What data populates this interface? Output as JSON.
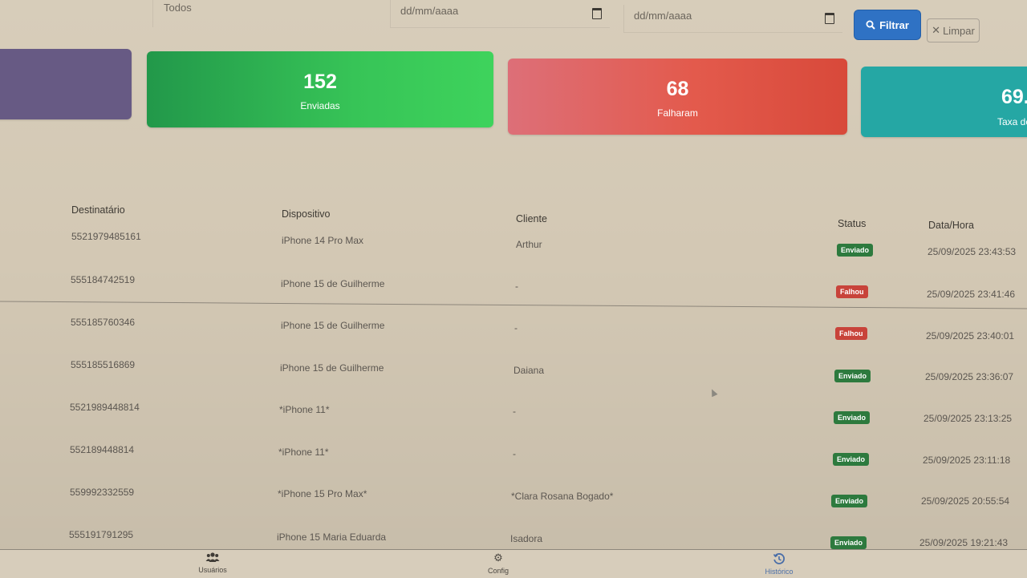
{
  "filters": {
    "status_value": "Todos",
    "date_start_placeholder": "dd/mm/aaaa",
    "date_end_placeholder": "dd/mm/aaaa",
    "filter_button": "Filtrar",
    "clear_button": "Limpar"
  },
  "stats": {
    "sent": {
      "value": "152",
      "label": "Enviadas"
    },
    "failed": {
      "value": "68",
      "label": "Falharam"
    },
    "rate": {
      "value": "69.",
      "label": "Taxa de"
    }
  },
  "table": {
    "columns": [
      "Destinatário",
      "Dispositivo",
      "Cliente",
      "Status",
      "Data/Hora"
    ],
    "rows": [
      {
        "recipient": "5521979485161",
        "device": "iPhone 14 Pro Max",
        "client": "Arthur",
        "status": "Enviado",
        "datetime": "25/09/2025 23:43:53"
      },
      {
        "recipient": "555184742519",
        "device": "iPhone 15 de Guilherme",
        "client": "-",
        "status": "Falhou",
        "datetime": "25/09/2025 23:41:46"
      },
      {
        "recipient": "555185760346",
        "device": "iPhone 15 de Guilherme",
        "client": "-",
        "status": "Falhou",
        "datetime": "25/09/2025 23:40:01"
      },
      {
        "recipient": "555185516869",
        "device": "iPhone 15 de Guilherme",
        "client": "Daiana",
        "status": "Enviado",
        "datetime": "25/09/2025 23:36:07"
      },
      {
        "recipient": "5521989448814",
        "device": "*iPhone 11*",
        "client": "-",
        "status": "Enviado",
        "datetime": "25/09/2025 23:13:25"
      },
      {
        "recipient": "552189448814",
        "device": "*iPhone 11*",
        "client": "-",
        "status": "Enviado",
        "datetime": "25/09/2025 23:11:18"
      },
      {
        "recipient": "559992332559",
        "device": "*iPhone 15 Pro Max*",
        "client": "*Clara Rosana Bogado*",
        "status": "Enviado",
        "datetime": "25/09/2025 20:55:54"
      },
      {
        "recipient": "555191791295",
        "device": "iPhone 15 Maria Eduarda",
        "client": "Isadora",
        "status": "Enviado",
        "datetime": "25/09/2025 19:21:43"
      }
    ]
  },
  "nav": {
    "users": {
      "label": "Usuários",
      "icon": "users-icon"
    },
    "config": {
      "label": "Config",
      "icon": "gear-icon"
    },
    "history": {
      "label": "Histórico",
      "icon": "history-icon"
    }
  },
  "colors": {
    "sent_card": "#37c457",
    "failed_card": "#e35a4c",
    "rate_card": "#25a7a4",
    "filter_button": "#2f72c4",
    "badge_sent": "#2d7a3e",
    "badge_failed": "#c8433a"
  }
}
